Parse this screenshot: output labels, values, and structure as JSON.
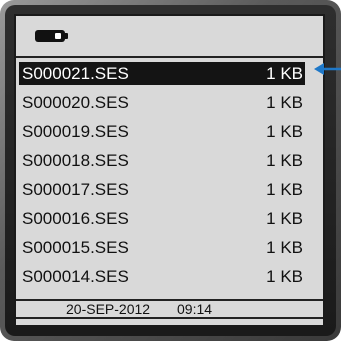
{
  "device": {
    "battery_icon": "battery-icon",
    "colors": {
      "screen_bg": "#d9d9d9",
      "selection_bg": "#141414",
      "pointer": "#1f78c8"
    }
  },
  "file_list": {
    "items": [
      {
        "name": "S000021.SES",
        "size": "1 KB",
        "selected": true
      },
      {
        "name": "S000020.SES",
        "size": "1 KB",
        "selected": false
      },
      {
        "name": "S000019.SES",
        "size": "1 KB",
        "selected": false
      },
      {
        "name": "S000018.SES",
        "size": "1 KB",
        "selected": false
      },
      {
        "name": "S000017.SES",
        "size": "1 KB",
        "selected": false
      },
      {
        "name": "S000016.SES",
        "size": "1 KB",
        "selected": false
      },
      {
        "name": "S000015.SES",
        "size": "1 KB",
        "selected": false
      },
      {
        "name": "S000014.SES",
        "size": "1 KB",
        "selected": false
      }
    ]
  },
  "status": {
    "date": "20-SEP-2012",
    "time": "09:14"
  },
  "annotation": {
    "icon": "arrow-left-icon"
  }
}
